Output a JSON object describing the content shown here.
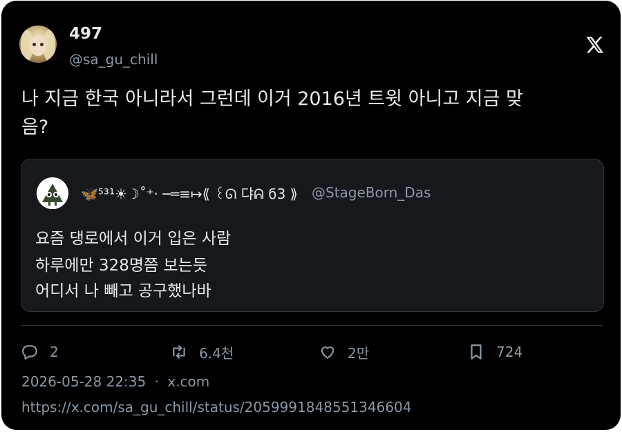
{
  "tweet": {
    "display_name": "497",
    "handle": "@sa_gu_chill",
    "text_line1": "나 지금 한국 아니라서 그런데 이거 2016년 트윗 아니고 지금 맞",
    "text_line2": "음?"
  },
  "quoted_tweet": {
    "display_name": "🦋⁵³¹☀︎☽︎˚⁺‧ ─═≡↦⟪ ꒰ᘏ 댜ᕱ ϭ3 ⟫",
    "handle": "@StageBorn_Das",
    "lines": [
      "요즘 댕로에서 이거 입은 사람",
      "하루에만 328명쯤 보는듯",
      "어디서 나 빼고 공구했나바"
    ]
  },
  "actions": {
    "replies": "2",
    "retweets": "6.4천",
    "likes": "2만",
    "bookmarks": "724"
  },
  "meta": {
    "timestamp": "2026-05-28 22:35",
    "separator": "·",
    "source": "x.com",
    "url": "https://x.com/sa_gu_chill/status/2059991848551346604"
  },
  "icons": {
    "logo": "x-logo-icon",
    "reply": "reply-icon",
    "retweet": "retweet-icon",
    "like": "heart-icon",
    "bookmark": "bookmark-icon"
  },
  "colors": {
    "background": "#000000",
    "text_primary": "#e7e9ea",
    "text_secondary": "#8b98a5",
    "quote_background": "#16181c",
    "border": "#333639"
  }
}
